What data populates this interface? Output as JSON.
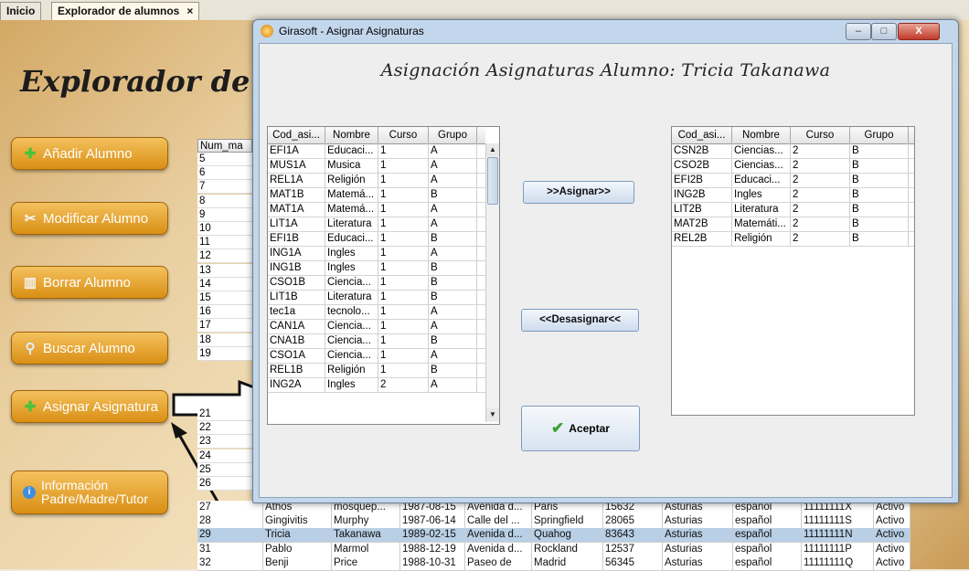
{
  "tabs": [
    {
      "label": "Inicio"
    },
    {
      "label": "Explorador de alumnos",
      "close": "×"
    }
  ],
  "background": {
    "title": "Explorador de",
    "sidebar_buttons": [
      {
        "label": "Añadir Alumno",
        "icon": "plus-icon"
      },
      {
        "label": "Modificar Alumno",
        "icon": "tools-icon"
      },
      {
        "label": "Borrar Alumno",
        "icon": "trash-icon"
      },
      {
        "label": "Buscar Alumno",
        "icon": "search-icon"
      },
      {
        "label": "Asignar Asignatura",
        "icon": "plus-icon"
      },
      {
        "label_line1": "Información",
        "label_line2": "Padre/Madre/Tutor",
        "icon": "info-icon"
      }
    ],
    "num_header": "Num_ma",
    "num_values": [
      "5",
      "6",
      "7",
      "8",
      "9",
      "10",
      "11",
      "12",
      "13",
      "14",
      "15",
      "16",
      "17",
      "18",
      "19"
    ],
    "num_values_lower": [
      "21",
      "22",
      "23",
      "24",
      "25",
      "26"
    ],
    "rows": [
      [
        "27",
        "Athos",
        "mosquep...",
        "1987-08-15",
        "Avenida d...",
        "Paris",
        "15632",
        "Asturias",
        "español",
        "11111111X",
        "Activo"
      ],
      [
        "28",
        "Gingivitis",
        "Murphy",
        "1987-06-14",
        "Calle del ...",
        "Springfield",
        "28065",
        "Asturias",
        "español",
        "11111111S",
        "Activo"
      ],
      [
        "29",
        "Tricia",
        "Takanawa",
        "1989-02-15",
        "Avenida d...",
        "Quahog",
        "83643",
        "Asturias",
        "español",
        "11111111N",
        "Activo"
      ],
      [
        "31",
        "Pablo",
        "Marmol",
        "1988-12-19",
        "Avenida d...",
        "Rockland",
        "12537",
        "Asturias",
        "español",
        "11111111P",
        "Activo"
      ],
      [
        "32",
        "Benji",
        "Price",
        "1988-10-31",
        "Paseo de",
        "Madrid",
        "56345",
        "Asturias",
        "español",
        "11111111Q",
        "Activo"
      ]
    ]
  },
  "dialog": {
    "title": "Girasoft - Asignar Asignaturas",
    "heading": "Asignación Asignaturas Alumno: Tricia Takanawa",
    "columns": [
      "Cod_asi...",
      "Nombre",
      "Curso",
      "Grupo"
    ],
    "available": [
      [
        "EFI1A",
        "Educaci...",
        "1",
        "A"
      ],
      [
        "MUS1A",
        "Musica",
        "1",
        "A"
      ],
      [
        "REL1A",
        "Religión",
        "1",
        "A"
      ],
      [
        "MAT1B",
        "Matemá...",
        "1",
        "B"
      ],
      [
        "MAT1A",
        "Matemá...",
        "1",
        "A"
      ],
      [
        "LIT1A",
        "Literatura",
        "1",
        "A"
      ],
      [
        "EFI1B",
        "Educaci...",
        "1",
        "B"
      ],
      [
        "ING1A",
        "Ingles",
        "1",
        "A"
      ],
      [
        "ING1B",
        "Ingles",
        "1",
        "B"
      ],
      [
        "CSO1B",
        "Ciencia...",
        "1",
        "B"
      ],
      [
        "LIT1B",
        "Literatura",
        "1",
        "B"
      ],
      [
        "tec1a",
        "tecnolo...",
        "1",
        "A"
      ],
      [
        "CAN1A",
        "Ciencia...",
        "1",
        "A"
      ],
      [
        "CNA1B",
        "Ciencia...",
        "1",
        "B"
      ],
      [
        "CSO1A",
        "Ciencia...",
        "1",
        "A"
      ],
      [
        "REL1B",
        "Religión",
        "1",
        "B"
      ],
      [
        "ING2A",
        "Ingles",
        "2",
        "A"
      ]
    ],
    "assigned": [
      [
        "CSN2B",
        "Ciencias...",
        "2",
        "B"
      ],
      [
        "CSO2B",
        "Ciencias...",
        "2",
        "B"
      ],
      [
        "EFI2B",
        "Educaci...",
        "2",
        "B"
      ],
      [
        "ING2B",
        "Ingles",
        "2",
        "B"
      ],
      [
        "LIT2B",
        "Literatura",
        "2",
        "B"
      ],
      [
        "MAT2B",
        "Matemáti...",
        "2",
        "B"
      ],
      [
        "REL2B",
        "Religión",
        "2",
        "B"
      ]
    ],
    "assign_label": ">>Asignar>>",
    "unassign_label": "<<Desasignar<<",
    "accept_label": "Aceptar",
    "window_buttons": {
      "minimize": "–",
      "maximize": "□",
      "close": "X"
    }
  },
  "colors": {
    "accent_orange": "#e09a1f",
    "selected_row": "#b8cfe5",
    "dialog_frame": "#c2d6ec"
  }
}
